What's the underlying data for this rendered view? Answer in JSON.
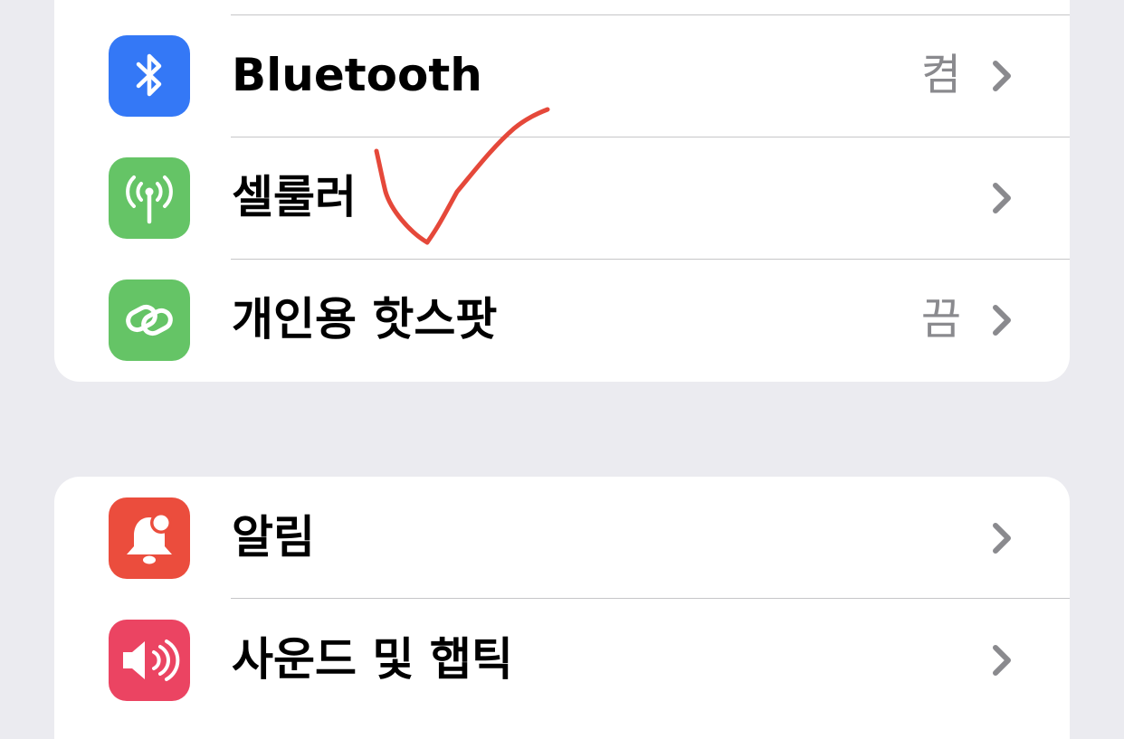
{
  "section1": {
    "rows": [
      {
        "label": "Bluetooth",
        "value": "켬",
        "icon": "bluetooth-icon",
        "icon_color": "#3478f6"
      },
      {
        "label": "셀룰러",
        "value": "",
        "icon": "cellular-antenna-icon",
        "icon_color": "#65c466"
      },
      {
        "label": "개인용 핫스팟",
        "value": "끔",
        "icon": "personal-hotspot-icon",
        "icon_color": "#65c466"
      }
    ]
  },
  "section2": {
    "rows": [
      {
        "label": "알림",
        "icon": "bell-icon",
        "icon_color": "#eb4d3d"
      },
      {
        "label": "사운드 및 햅틱",
        "icon": "speaker-icon",
        "icon_color": "#eb4462"
      }
    ]
  },
  "annotation": {
    "type": "handwritten-checkmark",
    "color": "#e5483a"
  },
  "colors": {
    "background": "#ebebf0",
    "card": "#ffffff",
    "separator": "#c6c6c8",
    "secondary_text": "#8a8a8e",
    "chevron": "#8a8a8e"
  }
}
